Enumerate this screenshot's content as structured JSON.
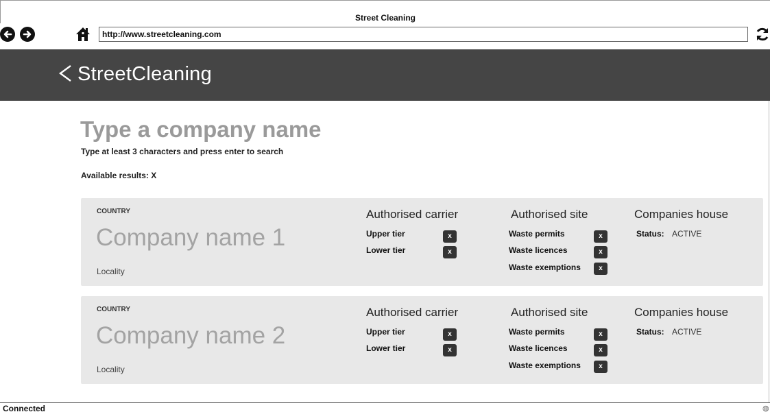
{
  "window": {
    "title": "Street Cleaning"
  },
  "toolbar": {
    "url": "http://www.streetcleaning.com"
  },
  "app": {
    "brand": "StreetCleaning"
  },
  "search": {
    "heading": "Type a company name",
    "hint": "Type at least 3 characters and press enter to search",
    "results_label": "Available results: X"
  },
  "results": [
    {
      "country": "COUNTRY",
      "company": "Company name 1",
      "locality": "Locality",
      "carrier": {
        "title": "Authorised carrier",
        "rows": [
          {
            "label": "Upper tier",
            "mark": "x"
          },
          {
            "label": "Lower tier",
            "mark": "x"
          }
        ]
      },
      "site": {
        "title": "Authorised site",
        "rows": [
          {
            "label": "Waste permits",
            "mark": "x"
          },
          {
            "label": "Waste licences",
            "mark": "x"
          },
          {
            "label": "Waste exemptions",
            "mark": "x"
          }
        ]
      },
      "companies_house": {
        "title": "Companies house",
        "status_label": "Status:",
        "status_value": "ACTIVE"
      }
    },
    {
      "country": "COUNTRY",
      "company": "Company name 2",
      "locality": "Locality",
      "carrier": {
        "title": "Authorised carrier",
        "rows": [
          {
            "label": "Upper tier",
            "mark": "x"
          },
          {
            "label": "Lower tier",
            "mark": "x"
          }
        ]
      },
      "site": {
        "title": "Authorised site",
        "rows": [
          {
            "label": "Waste permits",
            "mark": "x"
          },
          {
            "label": "Waste licences",
            "mark": "x"
          },
          {
            "label": "Waste exemptions",
            "mark": "x"
          }
        ]
      },
      "companies_house": {
        "title": "Companies house",
        "status_label": "Status:",
        "status_value": "ACTIVE"
      }
    }
  ],
  "statusbar": {
    "text": "Connected"
  },
  "icons": {
    "back": "back-arrow-icon",
    "forward": "forward-arrow-icon",
    "home": "home-icon",
    "refresh": "refresh-icon",
    "app_back": "chevron-left-icon",
    "globe": "globe-icon"
  },
  "colors": {
    "header_bg": "#454545",
    "card_bg": "#e8e8e8",
    "check_bg": "#333333",
    "heading_gray": "#9a9a9a"
  }
}
